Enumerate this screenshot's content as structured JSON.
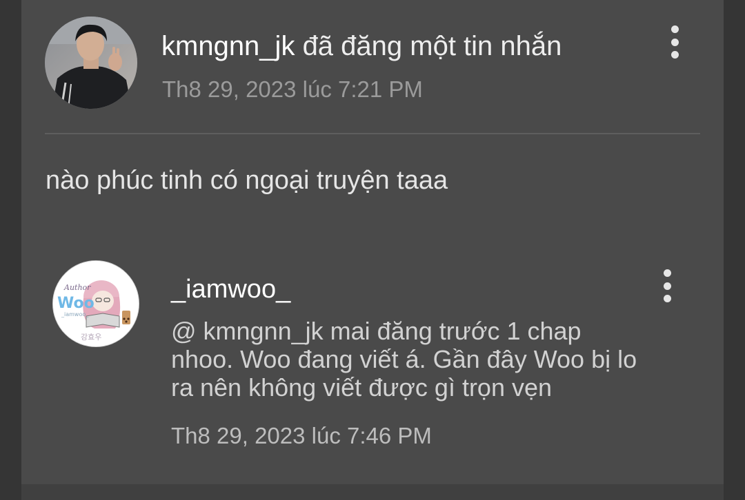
{
  "post": {
    "author": "kmngnn_jk",
    "action": "đã đăng một tin nhắn",
    "timestamp": "Th8 29, 2023 lúc 7:21 PM",
    "message": "nào phúc tinh có ngoại truyện taaa"
  },
  "reply": {
    "author": "_iamwoo_",
    "mention": "@ kmngnn_jk",
    "text_line1_rest": " mai đăng trước 1 chap",
    "text_line2": "nhoo. Woo đang viết á. Gần đây Woo bị lo",
    "text_line3": "ra nên không viết được gì trọn vẹn",
    "timestamp": "Th8 29, 2023 lúc 7:46 PM",
    "avatar_text": {
      "script": "Author",
      "brand": "Woo",
      "handle": "_iamwoo_",
      "korean": "강효우"
    }
  },
  "icons": {
    "post_menu": "more-vertical-icon",
    "reply_menu": "more-vertical-icon"
  },
  "colors": {
    "panel": "#4a4a4a",
    "background": "#353535",
    "text_primary": "#ffffff",
    "text_secondary": "#9b9b9b"
  }
}
